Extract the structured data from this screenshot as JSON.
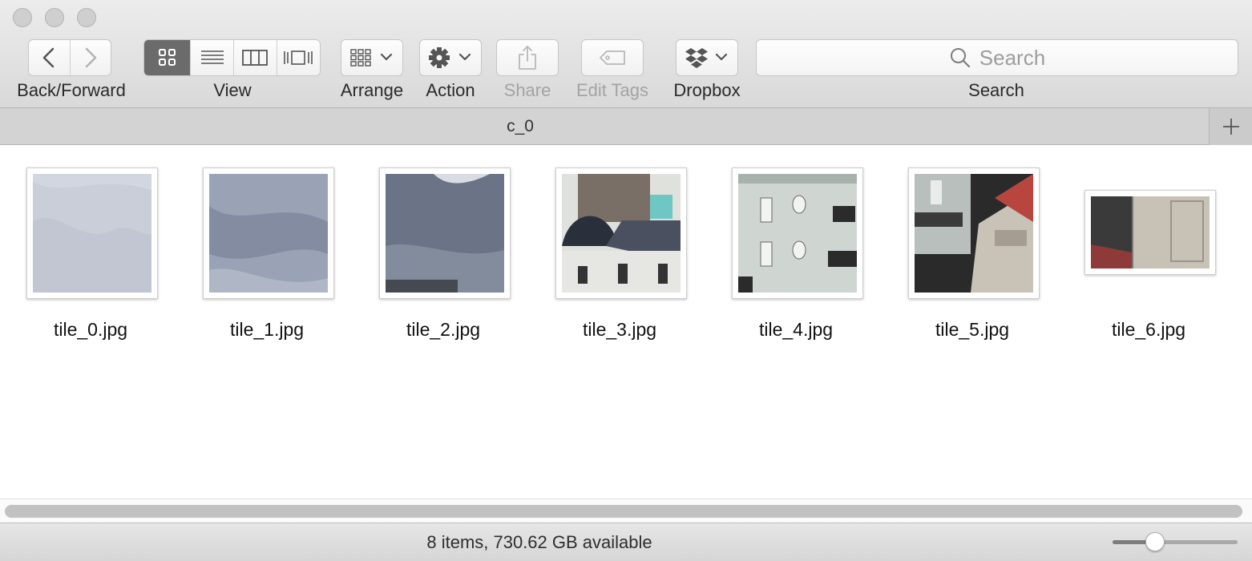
{
  "window": {
    "controls": [
      "close",
      "minimize",
      "zoom"
    ]
  },
  "toolbar": {
    "back_forward_label": "Back/Forward",
    "view_label": "View",
    "arrange_label": "Arrange",
    "action_label": "Action",
    "share_label": "Share",
    "edit_tags_label": "Edit Tags",
    "dropbox_label": "Dropbox",
    "search_label": "Search",
    "search_placeholder": "Search",
    "view_modes": [
      "icon-view",
      "list-view",
      "column-view",
      "cover-flow-view"
    ],
    "active_view": "icon-view",
    "icons": {
      "back": "chevron-left-icon",
      "forward": "chevron-right-icon",
      "arrange": "grid-arrange-icon",
      "action": "gear-icon",
      "share": "share-icon",
      "tags": "tag-icon",
      "dropbox": "dropbox-icon",
      "search": "search-icon"
    }
  },
  "tabbar": {
    "title": "c_0",
    "add_icon": "plus-icon"
  },
  "files": [
    {
      "name": "tile_0.jpg",
      "palette": [
        "#c9ced9",
        "#b9bfcc",
        "#d6dae3"
      ]
    },
    {
      "name": "tile_1.jpg",
      "palette": [
        "#9aa2b5",
        "#7e879c",
        "#b4bbca"
      ]
    },
    {
      "name": "tile_2.jpg",
      "palette": [
        "#6b7386",
        "#8a92a3",
        "#454a52"
      ]
    },
    {
      "name": "tile_3.jpg",
      "palette": [
        "#dfe1dc",
        "#2a2f3c",
        "#7a6f66"
      ]
    },
    {
      "name": "tile_4.jpg",
      "palette": [
        "#cfd6d2",
        "#a9b1ad",
        "#2b2b2b"
      ]
    },
    {
      "name": "tile_5.jpg",
      "palette": [
        "#c9c2b6",
        "#2a2a2a",
        "#b8463f"
      ]
    },
    {
      "name": "tile_6.jpg",
      "palette": [
        "#c8c1b6",
        "#3a3a3a",
        "#8e3a38"
      ]
    }
  ],
  "status": {
    "text": "8 items, 730.62 GB available"
  },
  "zoom_slider": {
    "value": 0.34
  },
  "colors": {
    "active_segment": "#6b6b6b",
    "toolbar_bg": "#e3e3e3"
  }
}
